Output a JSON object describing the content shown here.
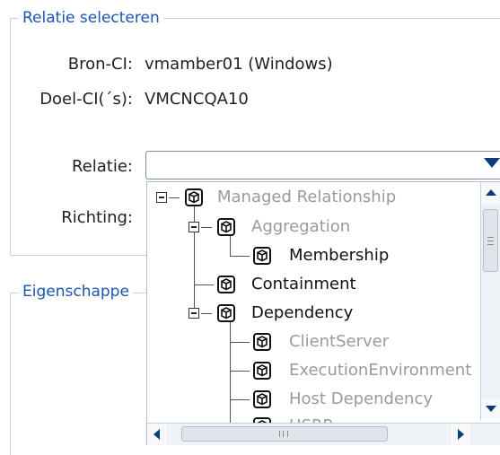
{
  "section_select": {
    "title": "Relatie selecteren",
    "source_label": "Bron-CI:",
    "source_value": "vmamber01 (Windows)",
    "target_label": "Doel-CI(´s):",
    "target_value": "VMCNCQA10",
    "relation_label": "Relatie:",
    "relation_value": "",
    "direction_label": "Richting:"
  },
  "section_properties": {
    "title": "Eigenschappe"
  },
  "tree": [
    {
      "label": "Managed Relationship",
      "state": "disabled",
      "icon": "ci-cube-icon"
    },
    {
      "label": "Aggregation",
      "state": "disabled",
      "icon": "ci-cube-icon"
    },
    {
      "label": "Membership",
      "state": "enabled",
      "icon": "ci-cube-icon"
    },
    {
      "label": "Containment",
      "state": "enabled",
      "icon": "ci-cube-icon"
    },
    {
      "label": "Dependency",
      "state": "enabled",
      "icon": "ci-cube-icon"
    },
    {
      "label": "ClientServer",
      "state": "disabled",
      "icon": "ci-cube-icon"
    },
    {
      "label": "ExecutionEnvironment",
      "state": "disabled",
      "icon": "ci-cube-icon"
    },
    {
      "label": "Host Dependency",
      "state": "disabled",
      "icon": "ci-cube-icon"
    },
    {
      "label": "HSRP",
      "state": "disabled",
      "icon": "ci-cube-icon"
    }
  ],
  "colors": {
    "legend": "#1a55b5",
    "disabled_text": "#9a9a9a",
    "enabled_text": "#111111",
    "scroll_arrow": "#0a3d79"
  }
}
